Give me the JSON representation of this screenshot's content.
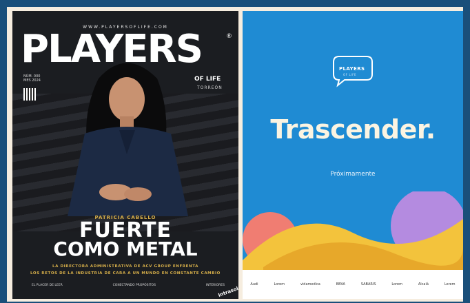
{
  "left_cover": {
    "url": "WWW.PLAYERSOFLIFE.COM",
    "brand": "PLAYERS",
    "registered": "®",
    "of_life": "OF LIFE",
    "city": "TORREÓN",
    "issue_meta": [
      "NÚM. 000",
      "MES 2024"
    ],
    "name": "PATRICIA CABELLO",
    "headline_1": "FUERTE",
    "headline_2": "COMO METAL",
    "subline_1": "LA DIRECTORA ADMINISTRATIVA DE ACV GROUP ENFRENTA",
    "subline_2": "LOS RETOS DE LA INDUSTRIA DE CARA A UN MUNDO EN CONSTANTE CAMBIO",
    "footer_items": [
      "EL PLACER DE LEER",
      "CONECTANDO PROPÓSITOS",
      "INTERIORES"
    ],
    "badge": "Intrasol"
  },
  "right_cover": {
    "logo_text": "PLAYERS",
    "logo_sub": "OF LIFE",
    "title": "Trascender.",
    "subtitle": "Próximamente",
    "sponsors": [
      "Audi",
      "Lorem",
      "vidamedica",
      "BBVA",
      "SABARIS",
      "Lorem",
      "Alcalá",
      "Lorem"
    ]
  },
  "colors": {
    "outer_bg": "#1a4f7a",
    "frame": "#f6eddf",
    "right_bg": "#1f8bd3",
    "gold": "#d8b04a"
  }
}
